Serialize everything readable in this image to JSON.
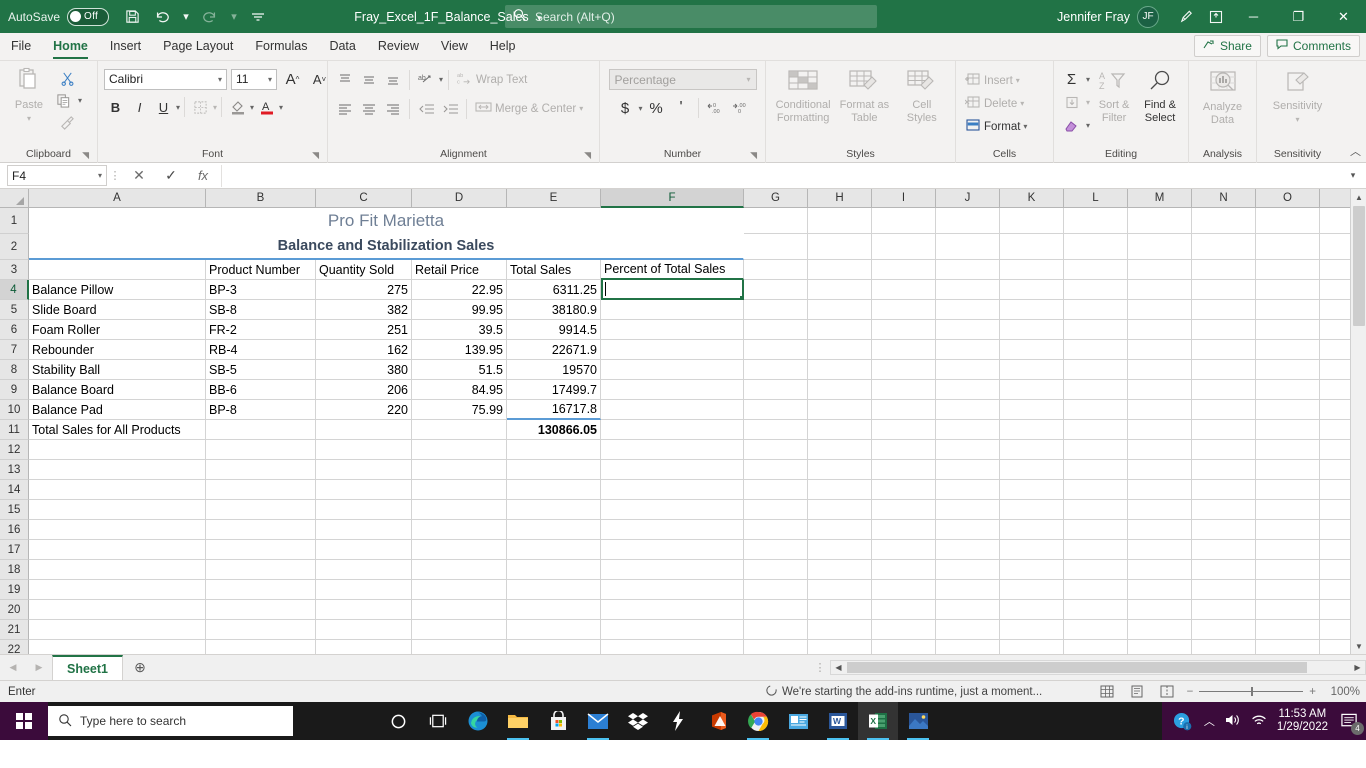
{
  "titlebar": {
    "autosave_label": "AutoSave",
    "autosave_state": "Off",
    "save_icon": "save-icon",
    "undo_icon": "undo-icon",
    "redo_icon": "redo-icon",
    "customize_icon": "customize-quick-access-icon",
    "document_title": "Fray_Excel_1F_Balance_Sales",
    "search_placeholder": "Search (Alt+Q)",
    "user_name": "Jennifer Fray",
    "user_initials": "JF",
    "pen_icon": "ink-pen-icon",
    "ribbon_display_icon": "ribbon-display-options-icon",
    "minimize": "─",
    "restore": "❐",
    "close": "✕"
  },
  "tabs": [
    {
      "label": "File",
      "active": false
    },
    {
      "label": "Home",
      "active": true
    },
    {
      "label": "Insert",
      "active": false
    },
    {
      "label": "Page Layout",
      "active": false
    },
    {
      "label": "Formulas",
      "active": false
    },
    {
      "label": "Data",
      "active": false
    },
    {
      "label": "Review",
      "active": false
    },
    {
      "label": "View",
      "active": false
    },
    {
      "label": "Help",
      "active": false
    }
  ],
  "tabbar_right": {
    "share_label": "Share",
    "comments_label": "Comments"
  },
  "ribbon": {
    "clipboard": {
      "group_label": "Clipboard",
      "paste_label": "Paste",
      "cut_label": "Cut",
      "copy_label": "Copy",
      "format_painter_label": "Format Painter"
    },
    "font": {
      "group_label": "Font",
      "font_name": "Calibri",
      "font_size": "11",
      "grow_label": "A",
      "shrink_label": "A",
      "bold": "B",
      "italic": "I",
      "underline": "U",
      "borders_label": "Borders",
      "fill_label": "Fill Color",
      "font_color_label": "Font Color"
    },
    "alignment": {
      "group_label": "Alignment",
      "wrap_text_label": "Wrap Text",
      "merge_center_label": "Merge & Center",
      "orientation_label": "Orientation"
    },
    "number": {
      "group_label": "Number",
      "format_value": "Percentage",
      "accounting_label": "$",
      "percent_label": "%",
      "comma_label": "'",
      "increase_decimal_label": "Increase Decimal",
      "decrease_decimal_label": "Decrease Decimal"
    },
    "styles": {
      "group_label": "Styles",
      "conditional_formatting_label": "Conditional\nFormatting",
      "conditional_formatting_l1": "Conditional",
      "conditional_formatting_l2": "Formatting",
      "format_as_table_l1": "Format as",
      "format_as_table_l2": "Table",
      "cell_styles_l1": "Cell",
      "cell_styles_l2": "Styles"
    },
    "cells": {
      "group_label": "Cells",
      "insert_label": "Insert",
      "delete_label": "Delete",
      "format_label": "Format"
    },
    "editing": {
      "group_label": "Editing",
      "autosum_label": "AutoSum",
      "fill_label": "Fill",
      "clear_label": "Clear",
      "sort_filter_l1": "Sort &",
      "sort_filter_l2": "Filter",
      "find_select_l1": "Find &",
      "find_select_l2": "Select"
    },
    "analysis": {
      "group_label": "Analysis",
      "analyze_data_l1": "Analyze",
      "analyze_data_l2": "Data"
    },
    "sensitivity": {
      "group_label": "Sensitivity",
      "sensitivity_label": "Sensitivity"
    },
    "collapse_icon": "collapse-ribbon-icon"
  },
  "formula_bar": {
    "name_box_value": "F4",
    "cancel_icon": "cancel-icon",
    "enter_icon": "enter-icon",
    "function_icon": "insert-function-icon",
    "formula_value": "",
    "expand_icon": "expand-formula-bar-icon"
  },
  "grid": {
    "columns": [
      "A",
      "B",
      "C",
      "D",
      "E",
      "F",
      "G",
      "H",
      "I",
      "J",
      "K",
      "L",
      "M",
      "N",
      "O"
    ],
    "selected_column": "F",
    "selected_row": 4,
    "active_cell": "F4",
    "rows": [
      1,
      2,
      3,
      4,
      5,
      6,
      7,
      8,
      9,
      10,
      11,
      12,
      13,
      14,
      15,
      16,
      17,
      18,
      19,
      20,
      21,
      22
    ],
    "title_line1": "Pro Fit Marietta",
    "title_line2": "Balance and Stabilization Sales",
    "headers": {
      "a": "",
      "b": "Product Number",
      "c": "Quantity Sold",
      "d": "Retail Price",
      "e": "Total Sales",
      "f": "Percent of Total Sales"
    },
    "data_rows": [
      {
        "product": "Balance Pillow",
        "number": "BP-3",
        "qty": "275",
        "price": "22.95",
        "total": "6311.25",
        "percent": ""
      },
      {
        "product": "Slide Board",
        "number": "SB-8",
        "qty": "382",
        "price": "99.95",
        "total": "38180.9",
        "percent": ""
      },
      {
        "product": "Foam Roller",
        "number": "FR-2",
        "qty": "251",
        "price": "39.5",
        "total": "9914.5",
        "percent": ""
      },
      {
        "product": "Rebounder",
        "number": "RB-4",
        "qty": "162",
        "price": "139.95",
        "total": "22671.9",
        "percent": ""
      },
      {
        "product": "Stability Ball",
        "number": "SB-5",
        "qty": "380",
        "price": "51.5",
        "total": "19570",
        "percent": ""
      },
      {
        "product": "Balance Board",
        "number": "BB-6",
        "qty": "206",
        "price": "84.95",
        "total": "17499.7",
        "percent": ""
      },
      {
        "product": "Balance Pad",
        "number": "BP-8",
        "qty": "220",
        "price": "75.99",
        "total": "16717.8",
        "percent": ""
      }
    ],
    "total_row": {
      "label": "Total Sales for All Products",
      "total": "130866.05"
    }
  },
  "sheetbar": {
    "prev_icon": "previous-sheet-icon",
    "next_icon": "next-sheet-icon",
    "sheet_name": "Sheet1",
    "add_sheet_icon": "add-sheet-icon"
  },
  "statusbar": {
    "mode": "Enter",
    "message": "We're starting the add-ins runtime, just a moment...",
    "view_normal_icon": "normal-view-icon",
    "view_pagelayout_icon": "page-layout-view-icon",
    "view_pagebreak_icon": "page-break-preview-icon",
    "zoom_out": "−",
    "zoom_in": "+",
    "zoom_level": "100%"
  },
  "taskbar": {
    "start_icon": "windows-start-icon",
    "search_placeholder": "Type here to search",
    "cortana_icon": "cortana-icon",
    "taskview_icon": "task-view-icon",
    "apps": [
      {
        "name": "edge-icon"
      },
      {
        "name": "file-explorer-icon"
      },
      {
        "name": "microsoft-store-icon"
      },
      {
        "name": "mail-icon"
      },
      {
        "name": "dropbox-icon"
      },
      {
        "name": "lightning-app-icon"
      },
      {
        "name": "office-icon"
      },
      {
        "name": "chrome-icon"
      },
      {
        "name": "presentation-app-icon"
      },
      {
        "name": "word-icon"
      },
      {
        "name": "excel-icon"
      },
      {
        "name": "photos-icon"
      }
    ],
    "tray": {
      "help_icon": "help-notification-icon",
      "chevron_icon": "show-hidden-icons-icon",
      "volume_icon": "volume-icon",
      "network_icon": "wifi-icon",
      "time": "11:53 AM",
      "date": "1/29/2022",
      "notification_count": "4"
    }
  },
  "colors": {
    "excel_green": "#217346",
    "title_blue": "#3b4a5e",
    "subtitle_gray": "#6f7f95",
    "selection_green": "#217346"
  }
}
